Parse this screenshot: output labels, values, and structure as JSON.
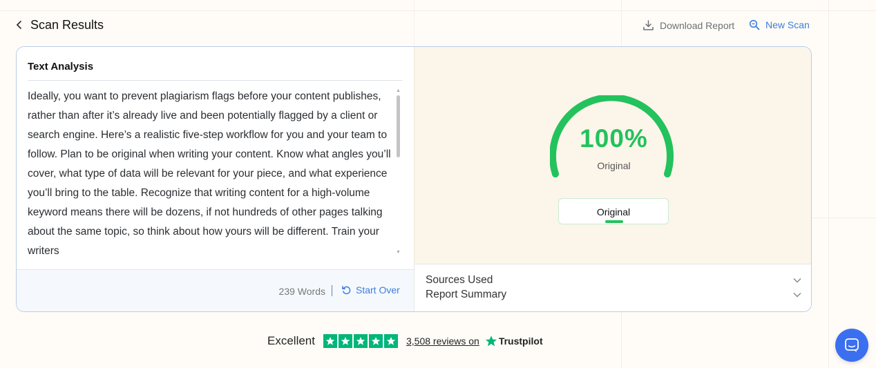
{
  "header": {
    "title": "Scan Results",
    "download_label": "Download Report",
    "new_scan_label": "New Scan"
  },
  "text_analysis": {
    "title": "Text Analysis",
    "content": "Ideally, you want to prevent plagiarism flags before your content publishes, rather than after it’s already live and been potentially flagged by a client or search engine.  Here’s a realistic five-step workflow for you and your team to follow.  Plan to be original when writing your content. Know what angles you’ll cover, what type of data will be relevant for your piece, and what experience you’ll bring to the table.  Recognize that writing content for a high-volume keyword means there will be dozens, if not hundreds of other pages talking about the same topic, so think about how yours will be different.  Train your writers",
    "word_count": "239 Words",
    "start_over_label": "Start Over"
  },
  "score": {
    "value": "100%",
    "label": "Original",
    "fraction": 1.0,
    "status_pill": "Original",
    "color": "#23c25c"
  },
  "accordion": {
    "sources_label": "Sources Used",
    "summary_label": "Report Summary"
  },
  "trustpilot": {
    "rating_word": "Excellent",
    "reviews_text": "3,508 reviews on",
    "brand": "Trustpilot",
    "star_color": "#00b67a"
  },
  "colors": {
    "accent": "#3b7ddd",
    "success": "#23c25c",
    "chat": "#3a6ff0"
  }
}
